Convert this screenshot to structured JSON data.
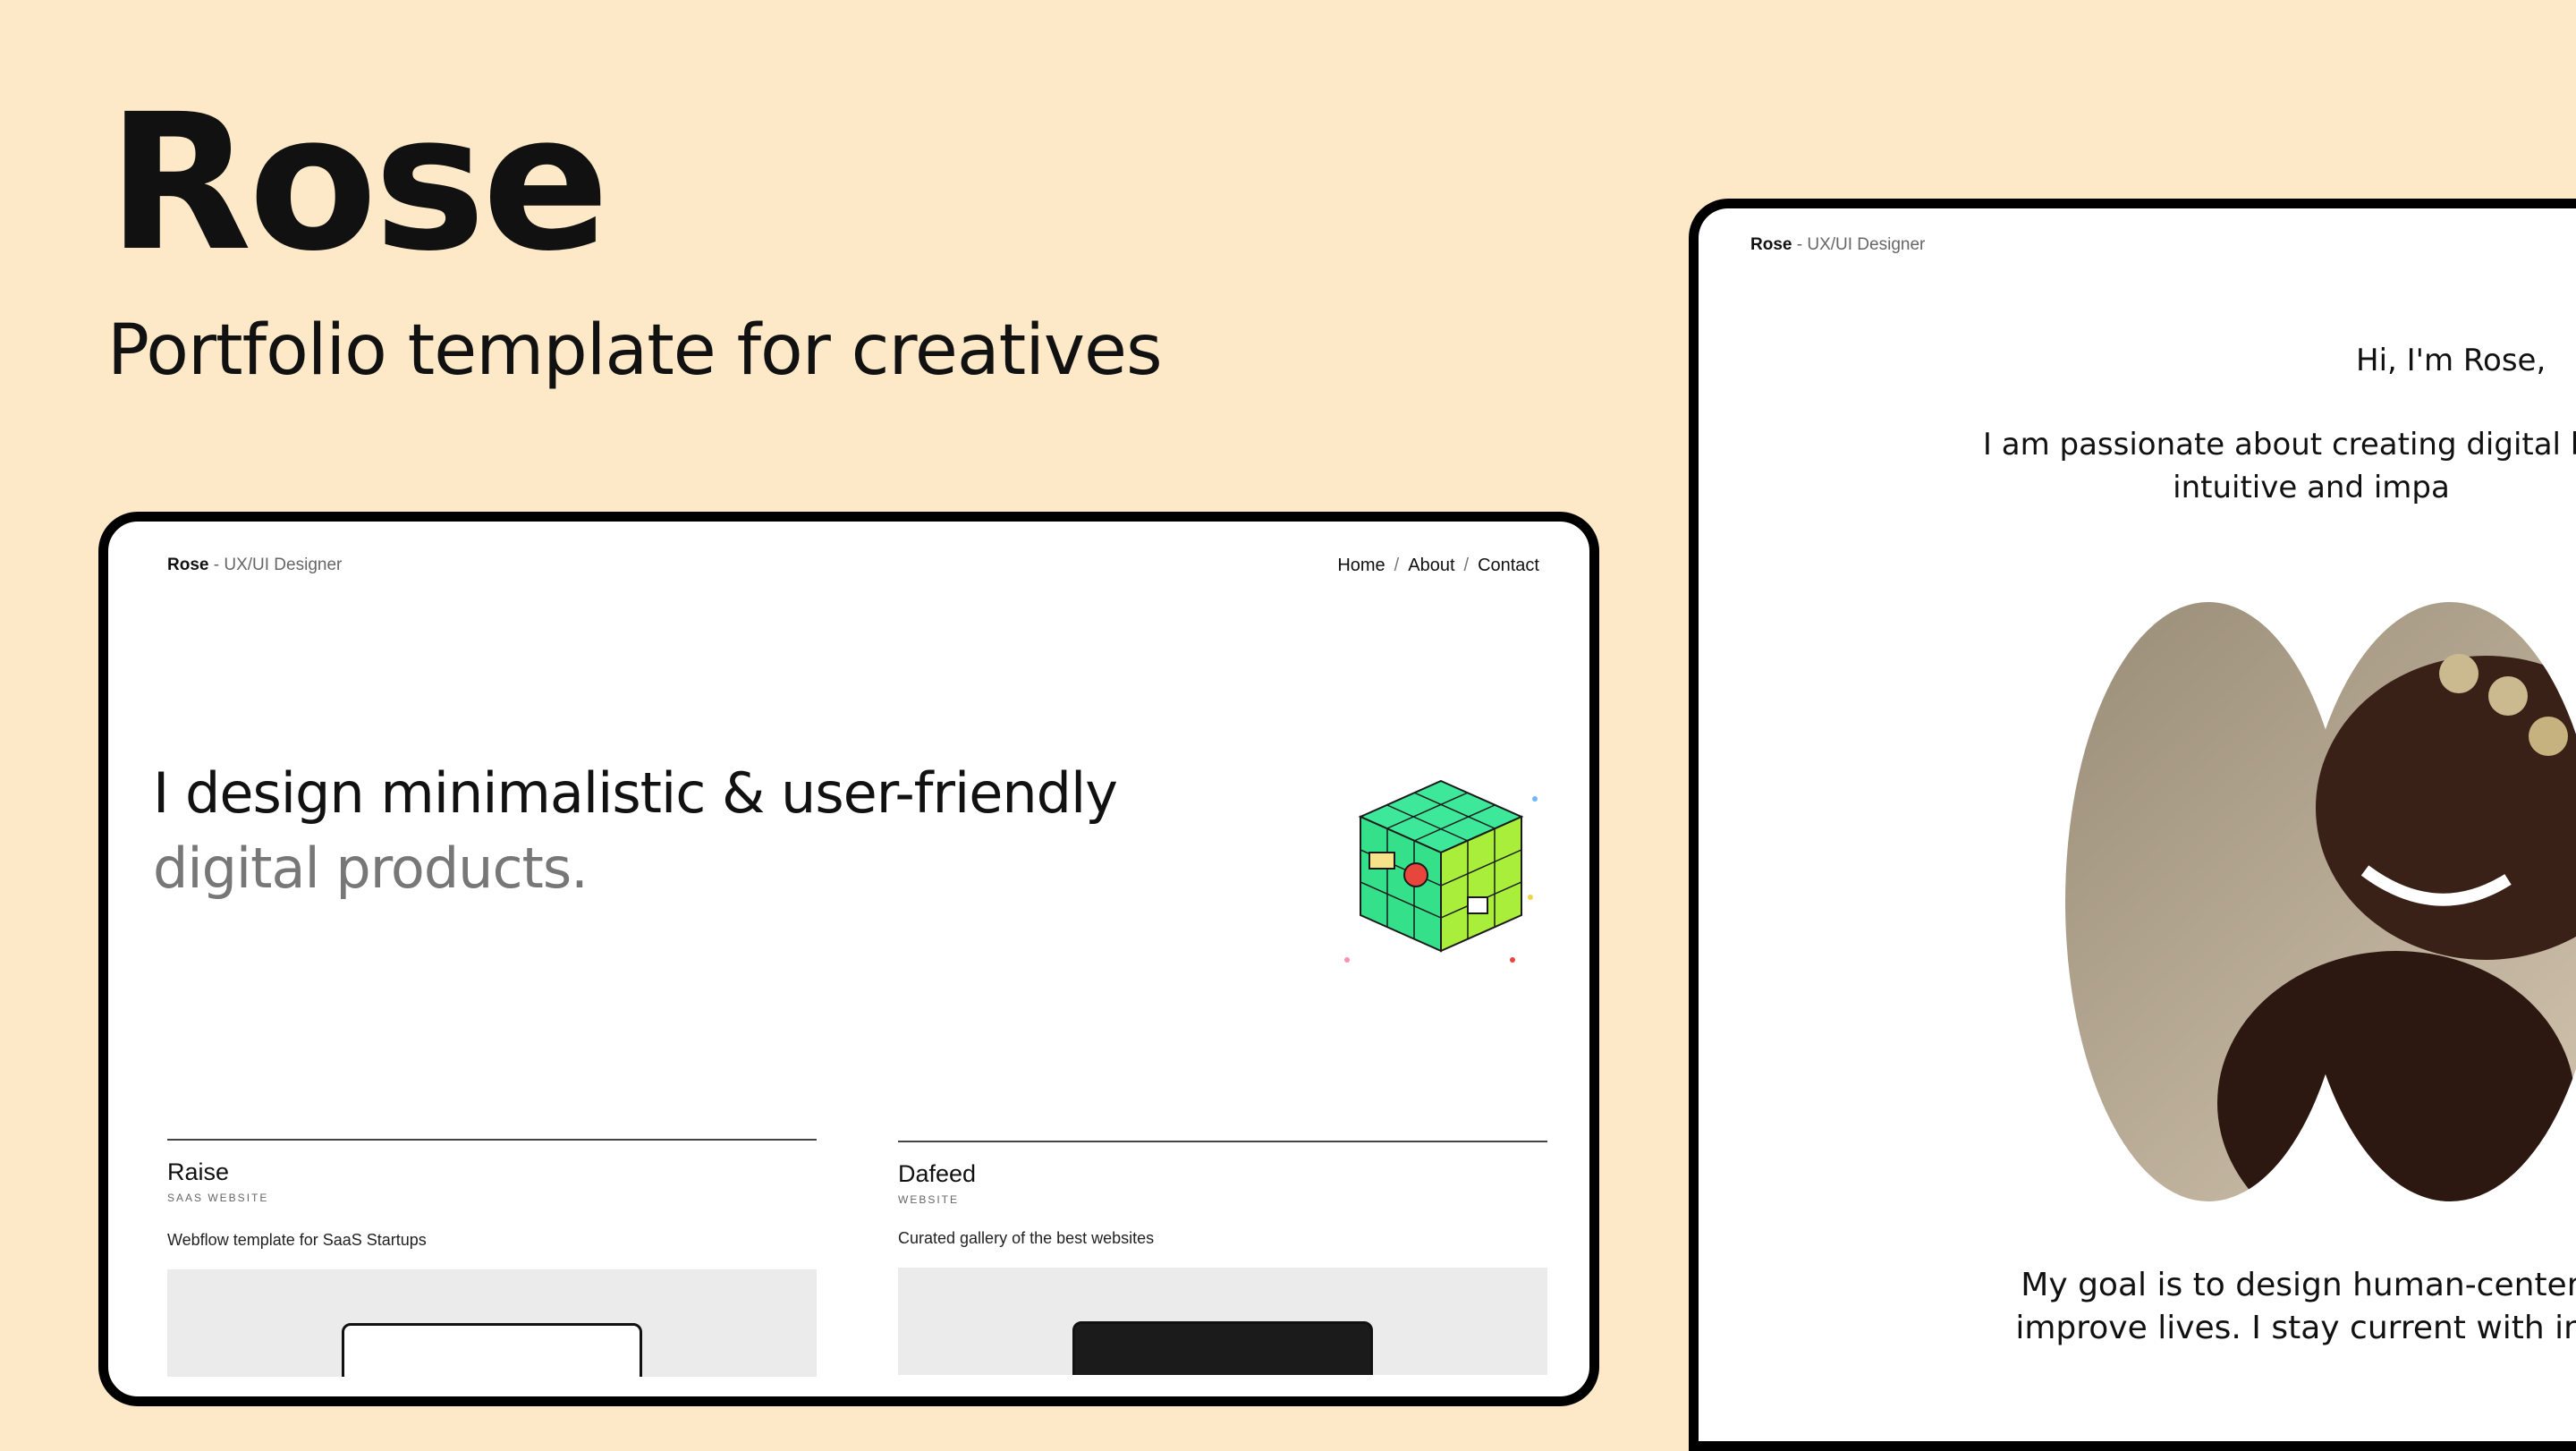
{
  "hero": {
    "title": "Rose",
    "subtitle": "Portfolio template for creatives"
  },
  "left_site": {
    "brand_name": "Rose",
    "brand_role": "- UX/UI Designer",
    "nav": [
      {
        "label": "Home"
      },
      {
        "label": "About"
      },
      {
        "label": "Contact"
      }
    ],
    "nav_separator": "/",
    "headline_line1": "I design minimalistic & user-friendly",
    "headline_line2": "digital products.",
    "projects": [
      {
        "name": "Raise",
        "tag": "SAAS WEBSITE",
        "description": "Webflow template for SaaS Startups"
      },
      {
        "name": "Dafeed",
        "tag": "WEBSITE",
        "description": "Curated gallery of the best websites"
      }
    ]
  },
  "right_site": {
    "brand_name": "Rose",
    "brand_role": "- UX/UI Designer",
    "greeting": "Hi, I'm Rose,",
    "intro": "I am passionate about creating digital both intuitive and impa",
    "goal": "My goal is to design human-centered improve lives. I stay current with indu"
  },
  "colors": {
    "background": "#fde9c8",
    "device_frame": "#000000",
    "cube_green": "#38e08a",
    "cube_lime": "#a8ee3a"
  }
}
